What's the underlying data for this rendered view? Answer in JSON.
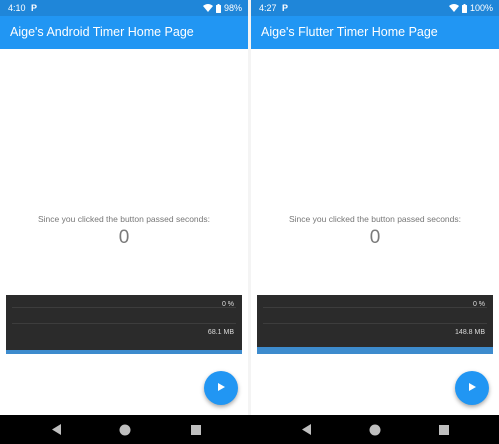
{
  "left_screen": {
    "status": {
      "time": "4:10",
      "notification": "P",
      "battery": "98%"
    },
    "title": "Aige's Android Timer Home Page",
    "caption": "Since you clicked the button passed seconds:",
    "counter": "0",
    "perf": {
      "cpu": "0 %",
      "memory": "68.1 MB",
      "memory_fill_fraction": 0.06
    },
    "fab_icon": "play-icon"
  },
  "right_screen": {
    "status": {
      "time": "4:27",
      "notification": "P",
      "battery": "100%"
    },
    "title": "Aige's Flutter Timer Home Page",
    "caption": "Since you clicked the button passed seconds:",
    "counter": "0",
    "perf": {
      "cpu": "0 %",
      "memory": "148.8 MB",
      "memory_fill_fraction": 0.12
    },
    "fab_icon": "play-icon"
  },
  "navbar": {
    "icons": [
      "back-icon",
      "home-icon",
      "recents-icon"
    ]
  },
  "colors": {
    "status_bar": "#1f86d9",
    "app_bar": "#2196f3",
    "fab": "#2196f3",
    "perf_bg": "#2b2b2b",
    "memory_bar": "#3d8bcd"
  }
}
